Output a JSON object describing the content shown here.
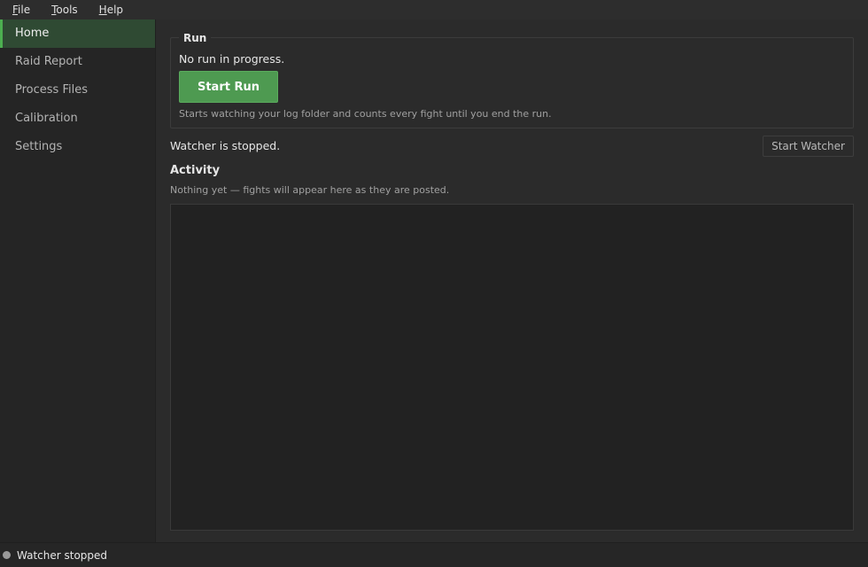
{
  "menubar": {
    "items": [
      {
        "mnemonic": "F",
        "rest": "ile"
      },
      {
        "mnemonic": "T",
        "rest": "ools"
      },
      {
        "mnemonic": "H",
        "rest": "elp"
      }
    ]
  },
  "sidebar": {
    "items": [
      {
        "label": "Home",
        "active": true
      },
      {
        "label": "Raid Report"
      },
      {
        "label": "Process Files"
      },
      {
        "label": "Calibration"
      },
      {
        "label": "Settings"
      }
    ]
  },
  "run": {
    "legend": "Run",
    "status": "No run in progress.",
    "start_label": "Start Run",
    "hint": "Starts watching your log folder and counts every fight until you end the run."
  },
  "watcher": {
    "status": "Watcher is stopped.",
    "button_label": "Start Watcher"
  },
  "activity": {
    "title": "Activity",
    "hint": "Nothing yet — fights will appear here as they are posted."
  },
  "statusbar": {
    "indicator_icon": "status-dot-icon",
    "text": "Watcher stopped"
  },
  "colors": {
    "accent": "#4caf50",
    "button_green": "#4e9a51",
    "background": "#2b2b2b",
    "sidebar": "#252525"
  }
}
